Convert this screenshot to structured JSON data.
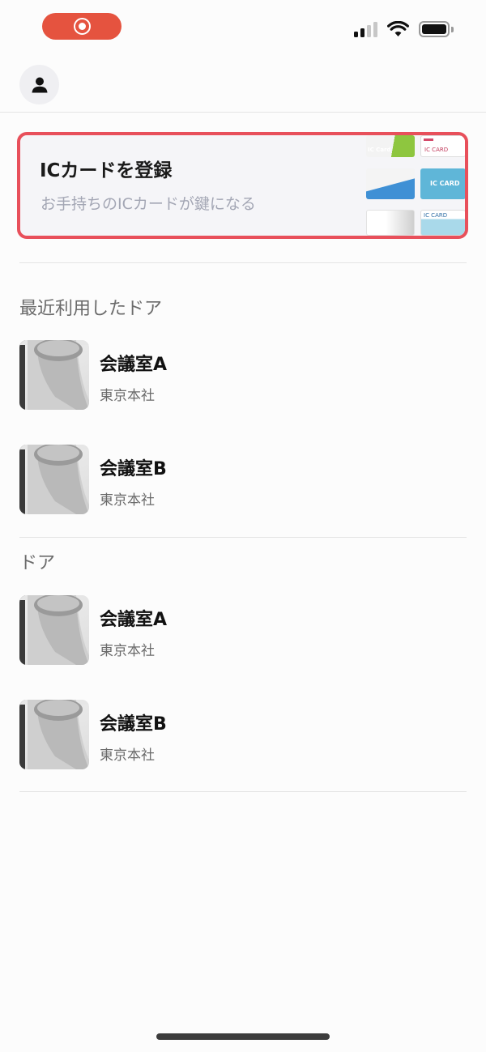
{
  "status_bar": {
    "recording_indicator": "record-icon",
    "icons": [
      "cellular-signal-icon",
      "wifi-icon",
      "battery-icon"
    ]
  },
  "header": {
    "profile_icon": "person-icon"
  },
  "ic_card_banner": {
    "title": "ICカードを登録",
    "subtitle": "お手持ちのICカードが鍵になる",
    "border_color": "#e8505b",
    "card_labels": [
      "IC Card",
      "IC CARD",
      "IC CARD",
      "IC CARD"
    ]
  },
  "sections": {
    "recent": {
      "title": "最近利用したドア",
      "items": [
        {
          "name": "会議室A",
          "location": "東京本社"
        },
        {
          "name": "会議室B",
          "location": "東京本社"
        }
      ]
    },
    "doors": {
      "title": "ドア",
      "items": [
        {
          "name": "会議室A",
          "location": "東京本社"
        },
        {
          "name": "会議室B",
          "location": "東京本社"
        }
      ]
    }
  },
  "colors": {
    "accent_red": "#e5533f",
    "highlight_border": "#e8505b",
    "subtitle_gray": "#a3a6b4"
  }
}
